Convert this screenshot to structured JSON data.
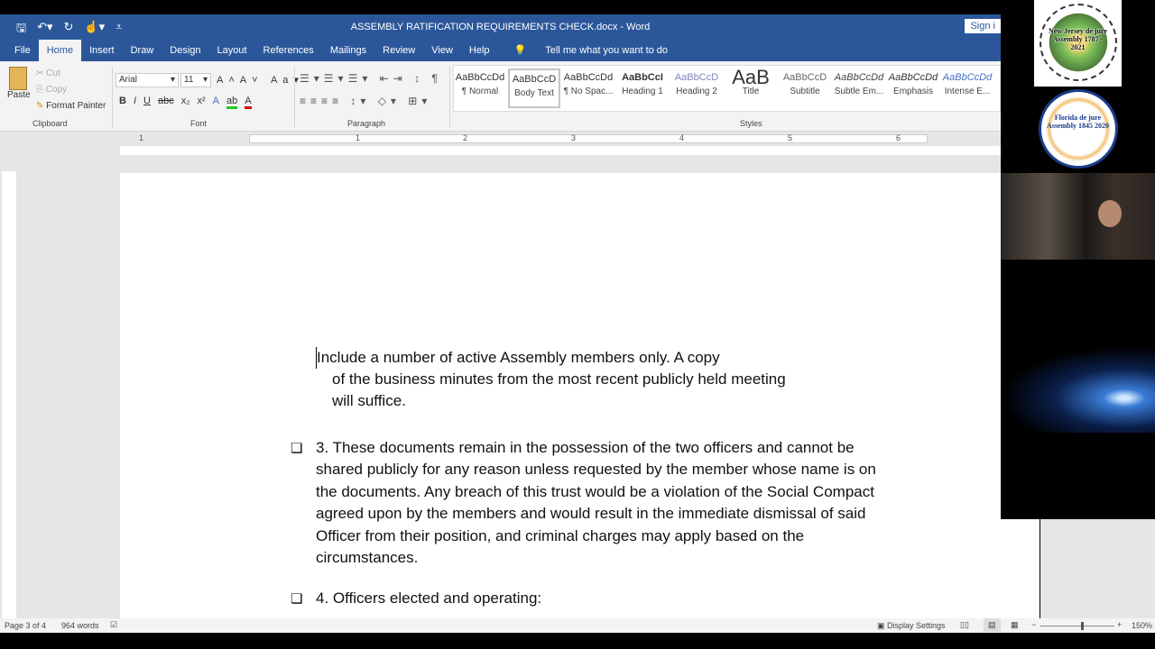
{
  "window": {
    "title": "ASSEMBLY RATIFICATION REQUIREMENTS CHECK.docx - Word",
    "sign_in": "Sign i"
  },
  "tabs": [
    "File",
    "Home",
    "Insert",
    "Draw",
    "Design",
    "Layout",
    "References",
    "Mailings",
    "Review",
    "View",
    "Help"
  ],
  "tell_me": "Tell me what you want to do",
  "clipboard": {
    "paste": "Paste",
    "cut": "Cut",
    "copy": "Copy",
    "format_painter": "Format Painter",
    "label": "Clipboard"
  },
  "font": {
    "name": "Arial",
    "size": "11",
    "label": "Font"
  },
  "paragraph": {
    "label": "Paragraph"
  },
  "styles": {
    "label": "Styles",
    "items": [
      {
        "preview": "AaBbCcDd",
        "name": "¶ Normal",
        "color": "#111"
      },
      {
        "preview": "AaBbCcD",
        "name": "Body Text",
        "color": "#111"
      },
      {
        "preview": "AaBbCcDd",
        "name": "¶ No Spac...",
        "color": "#111"
      },
      {
        "preview": "AaBbCcI",
        "name": "Heading 1",
        "color": "#111"
      },
      {
        "preview": "AaBbCcD",
        "name": "Heading 2",
        "color": "#7b86c0"
      },
      {
        "preview": "AaB",
        "name": "Title",
        "color": "#111"
      },
      {
        "preview": "AaBbCcD",
        "name": "Subtitle",
        "color": "#666"
      },
      {
        "preview": "AaBbCcDd",
        "name": "Subtle Em...",
        "color": "#444"
      },
      {
        "preview": "AaBbCcDd",
        "name": "Emphasis",
        "color": "#111"
      },
      {
        "preview": "AaBbCcDd",
        "name": "Intense E...",
        "color": "#4472c4"
      }
    ]
  },
  "ruler": [
    "1",
    "1",
    "2",
    "3",
    "4",
    "5",
    "6"
  ],
  "document": {
    "para1": [
      "Include a number of active Assembly members only. A copy",
      "of the business minutes from the most recent publicly held meeting",
      "will suffice."
    ],
    "item3": [
      "3. These documents remain in the possession of the two officers and cannot be",
      "shared publicly for any reason unless requested by the member whose name is on",
      "the documents. Any breach of this trust would be a violation of the Social Compact",
      "agreed upon by the members and would result in the immediate dismissal of said",
      "Officer from their position, and criminal charges may apply based on the",
      "circumstances."
    ],
    "item4": "4. Officers elected and operating:",
    "bullet": "❏"
  },
  "status": {
    "page": "Page 3 of 4",
    "words": "964 words",
    "display_settings": "Display Settings",
    "zoom": "150%",
    "zoom_percent": 150
  },
  "video": {
    "logo1_text": "New Jersey de jure Assembly 1787 - 2021",
    "logo2_text": "Florida de jure Assembly 1845 2020"
  }
}
